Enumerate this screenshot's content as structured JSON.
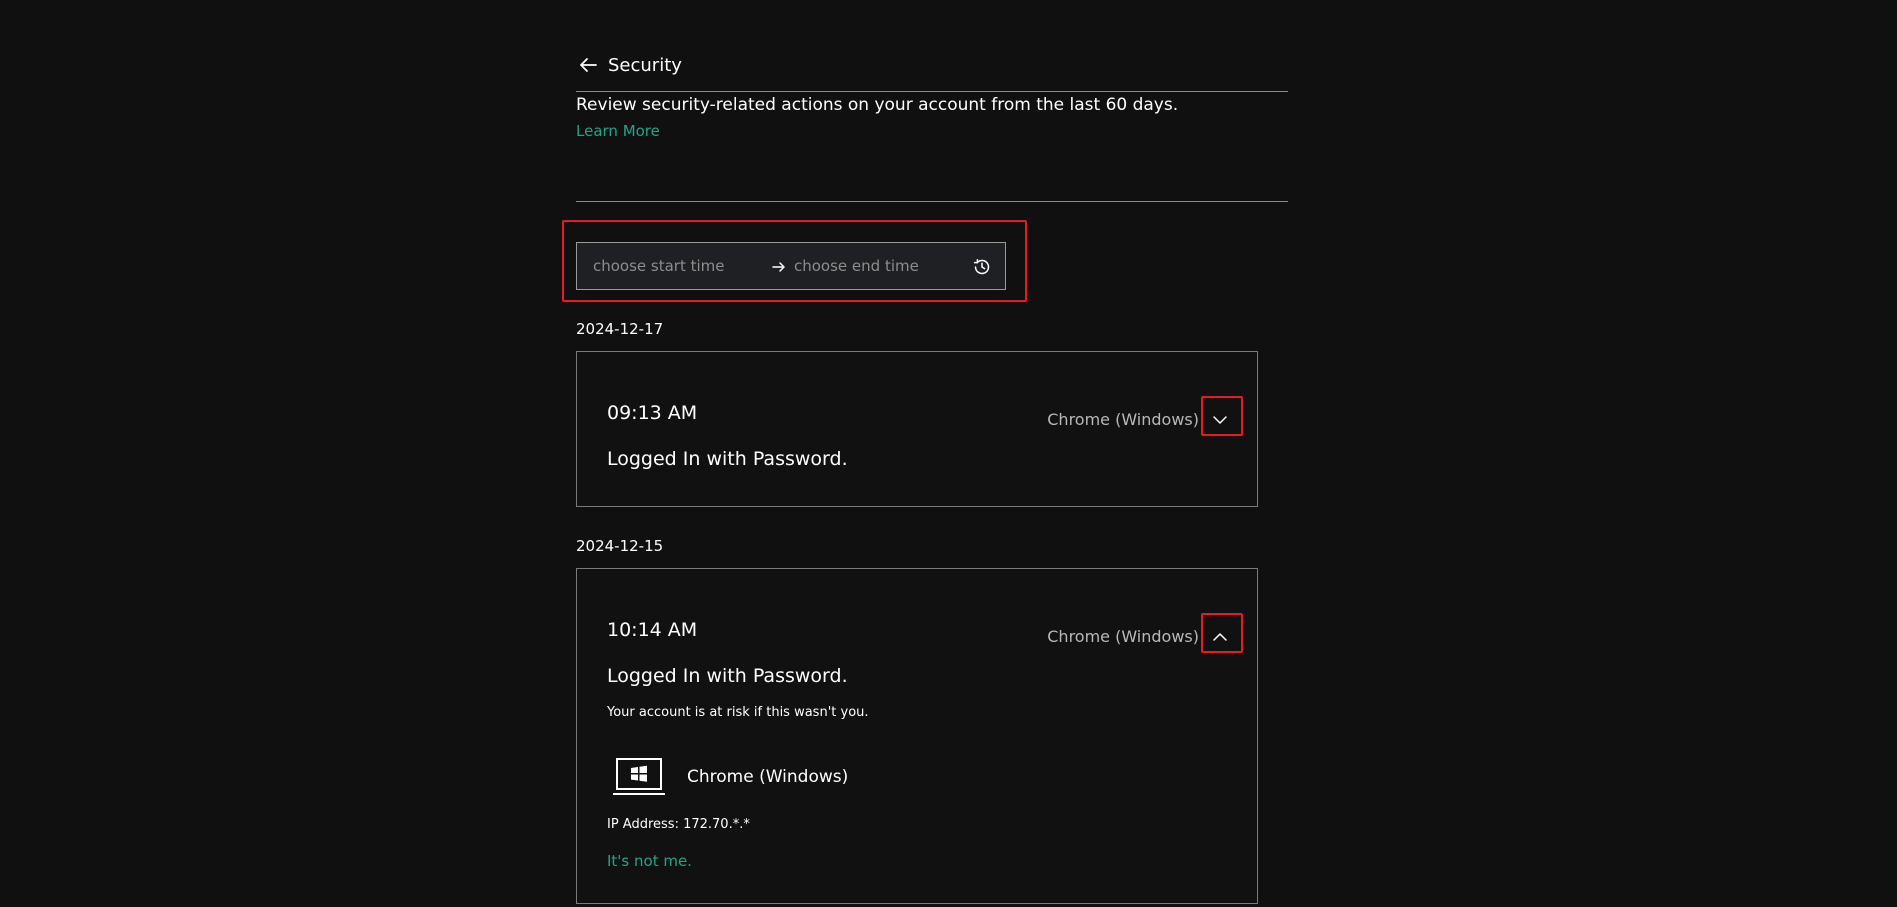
{
  "header": {
    "title": "Security"
  },
  "intro": {
    "description": "Review security-related actions on your account from the last 60 days.",
    "learn_more": "Learn More"
  },
  "range_picker": {
    "start_placeholder": "choose start time",
    "end_placeholder": "choose end time"
  },
  "colors": {
    "accent": "#1fa58a",
    "highlight": "#e81c1c",
    "background": "#101010"
  },
  "events": [
    {
      "date": "2024-12-17",
      "time": "09:13 AM",
      "event": "Logged In with Password.",
      "device": "Chrome (Windows)",
      "expanded": false
    },
    {
      "date": "2024-12-15",
      "time": "10:14 AM",
      "event": "Logged In with Password.",
      "device": "Chrome (Windows)",
      "expanded": true,
      "details": {
        "risk_text": "Your account is at risk if this wasn't you.",
        "device_name": "Chrome (Windows)",
        "ip_address": "IP Address: 172.70.*.*",
        "not_me": "It's not me."
      }
    }
  ]
}
